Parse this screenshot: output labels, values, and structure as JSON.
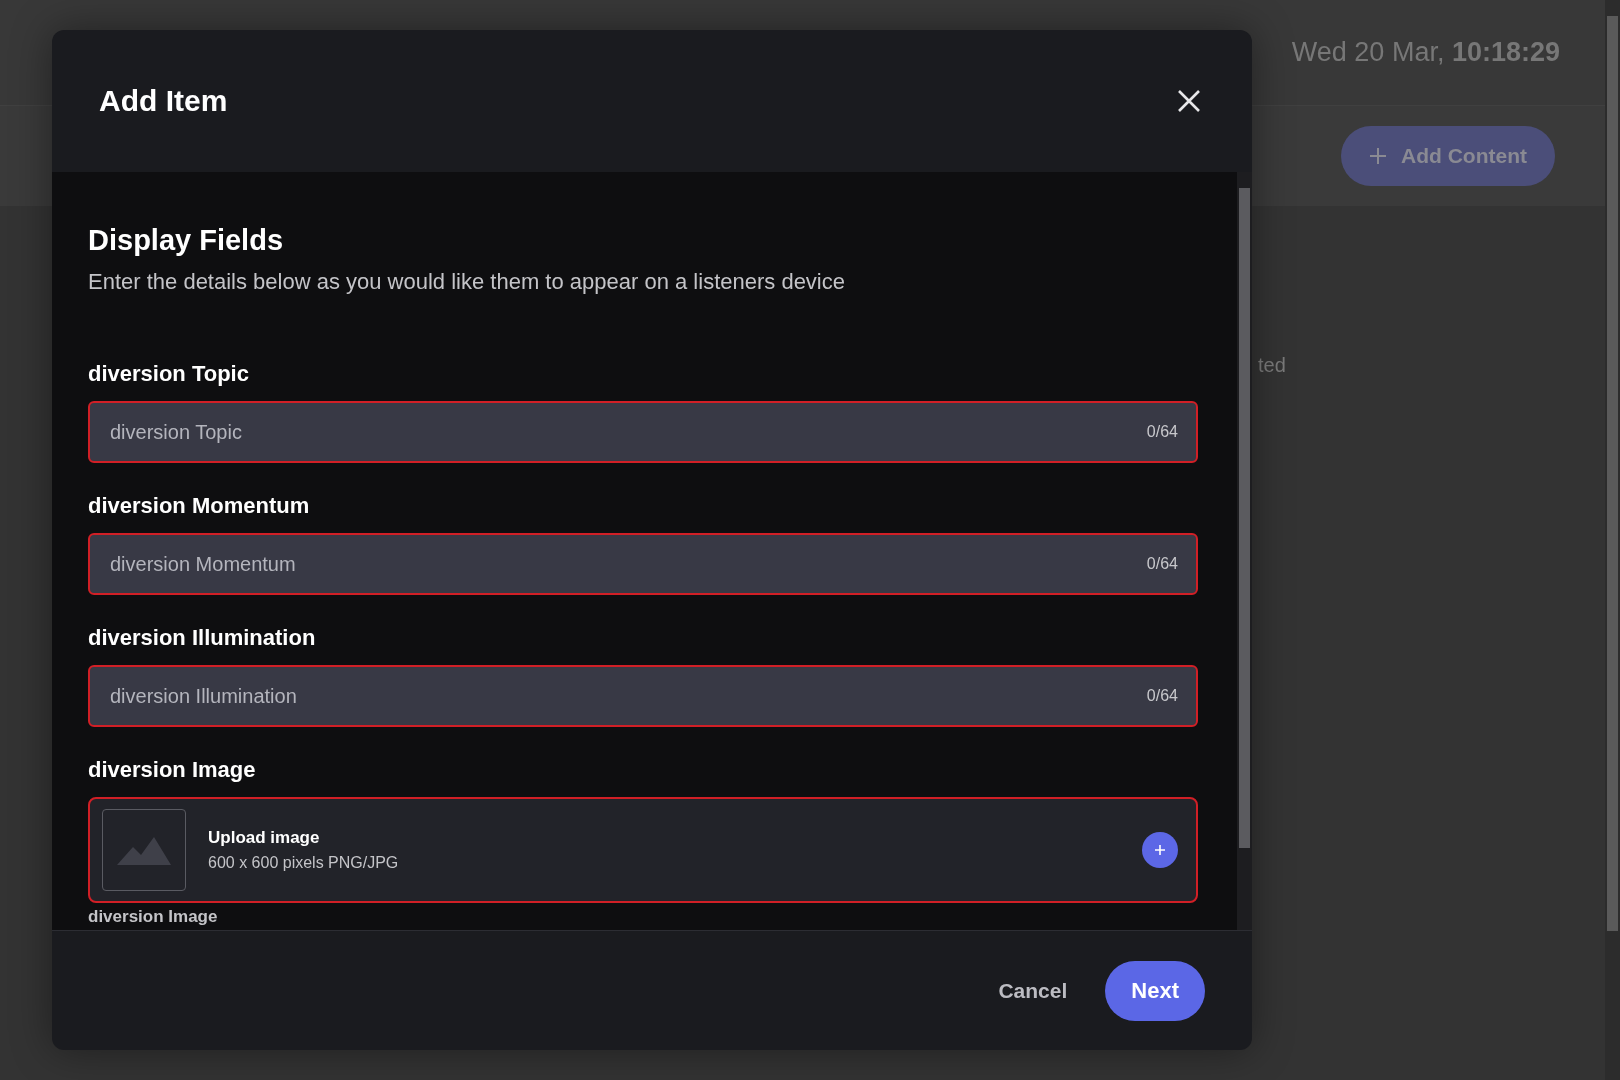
{
  "background": {
    "date": "Wed 20 Mar, ",
    "time": "10:18:29",
    "add_button": "Add Content",
    "partial_text": "ted"
  },
  "dialog": {
    "title": "Add Item",
    "section_title": "Display Fields",
    "section_subtitle": "Enter the details below as you would like them to appear on a listeners device",
    "fields": [
      {
        "kind": "text",
        "label": "diversion Topic",
        "placeholder": "diversion Topic",
        "counter": "0/64",
        "error": true
      },
      {
        "kind": "text",
        "label": "diversion Momentum",
        "placeholder": "diversion Momentum",
        "counter": "0/64",
        "error": true
      },
      {
        "kind": "text",
        "label": "diversion Illumination",
        "placeholder": "diversion Illumination",
        "counter": "0/64",
        "error": true
      },
      {
        "kind": "image",
        "label": "diversion Image",
        "upload_title": "Upload image",
        "upload_hint": "600 x 600 pixels PNG/JPG",
        "helper": "diversion Image",
        "error": true
      }
    ],
    "buttons": {
      "cancel": "Cancel",
      "next": "Next"
    }
  }
}
